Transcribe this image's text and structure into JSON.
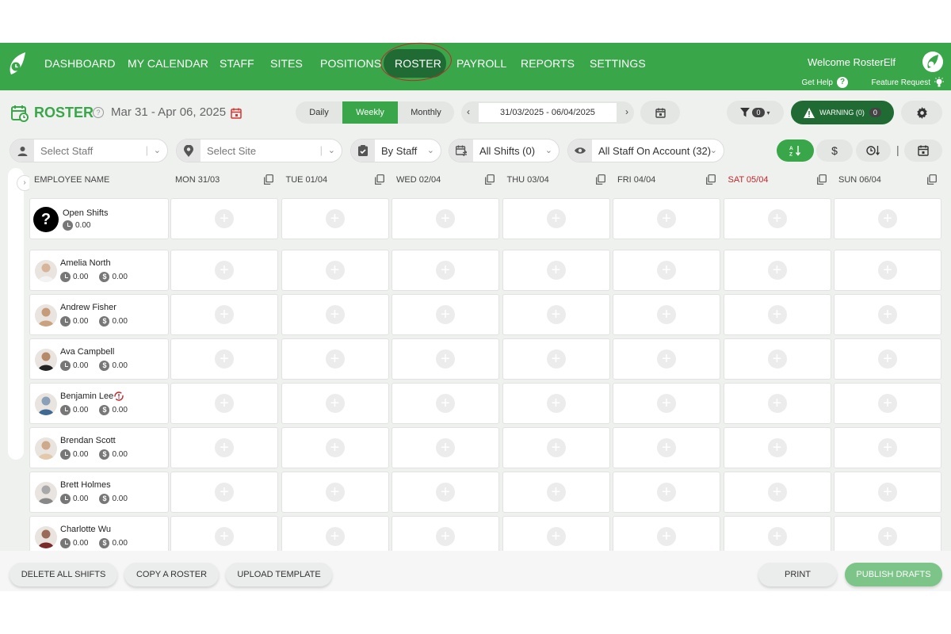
{
  "nav": {
    "items": [
      "DASHBOARD",
      "MY CALENDAR",
      "STAFF",
      "SITES",
      "POSITIONS",
      "ROSTER",
      "PAYROLL",
      "REPORTS",
      "SETTINGS"
    ],
    "active": "ROSTER",
    "welcome": "Welcome RosterElf",
    "help": "Get Help",
    "feature": "Feature Request"
  },
  "title": {
    "label": "ROSTER",
    "date_range": "Mar 31 - Apr 06, 2025"
  },
  "view": {
    "daily": "Daily",
    "weekly": "Weekly",
    "monthly": "Monthly",
    "active": "Weekly"
  },
  "date_nav": {
    "dates": "31/03/2025 - 06/04/2025"
  },
  "filter_count": "0",
  "warning": {
    "label": "WARNING (0)",
    "count": "0"
  },
  "filters": {
    "staff_placeholder": "Select Staff",
    "site_placeholder": "Select Site",
    "group_by": "By Staff",
    "shifts": "All Shifts (0)",
    "visibility": "All Staff On Account (32)"
  },
  "grid": {
    "name_header": "EMPLOYEE NAME",
    "days": [
      {
        "label": "MON 31/03",
        "weekend": false
      },
      {
        "label": "TUE 01/04",
        "weekend": false
      },
      {
        "label": "WED 02/04",
        "weekend": false
      },
      {
        "label": "THU 03/04",
        "weekend": false
      },
      {
        "label": "FRI 04/04",
        "weekend": false
      },
      {
        "label": "SAT 05/04",
        "weekend": true
      },
      {
        "label": "SUN 06/04",
        "weekend": false
      }
    ],
    "open_shifts": {
      "name": "Open Shifts",
      "hours": "0.00"
    },
    "employees": [
      {
        "name": "Amelia North",
        "hours": "0.00",
        "cost": "0.00"
      },
      {
        "name": "Andrew Fisher",
        "hours": "0.00",
        "cost": "0.00"
      },
      {
        "name": "Ava Campbell",
        "hours": "0.00",
        "cost": "0.00"
      },
      {
        "name": "Benjamin Lee",
        "hours": "0.00",
        "cost": "0.00",
        "flag": true
      },
      {
        "name": "Brendan Scott",
        "hours": "0.00",
        "cost": "0.00"
      },
      {
        "name": "Brett Holmes",
        "hours": "0.00",
        "cost": "0.00"
      },
      {
        "name": "Charlotte Wu",
        "hours": "0.00",
        "cost": "0.00"
      }
    ]
  },
  "bottom": {
    "delete": "DELETE ALL SHIFTS",
    "copy": "COPY A ROSTER",
    "upload": "UPLOAD TEMPLATE",
    "print": "PRINT",
    "publish": "PUBLISH DRAFTS"
  },
  "colors": {
    "brand": "#3aa64a",
    "brand_dark": "#1f6b33",
    "weekend": "#c1272d"
  }
}
